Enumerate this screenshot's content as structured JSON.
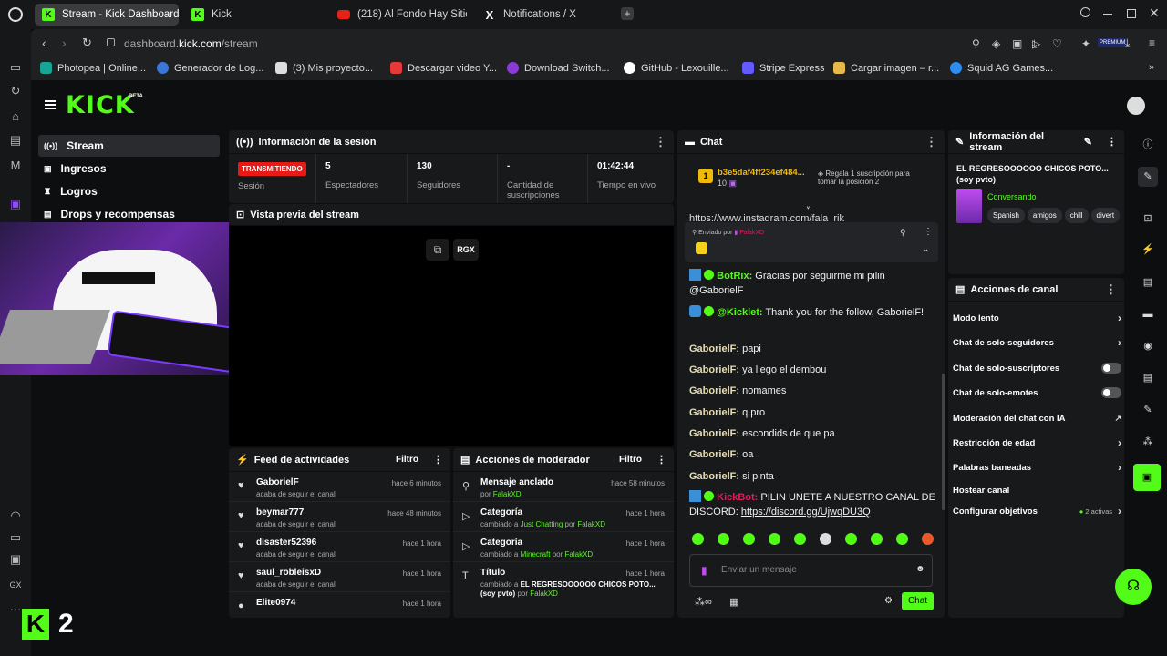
{
  "browser": {
    "tabs": [
      {
        "label": "Stream - Kick Dashboard",
        "icon": "kick"
      },
      {
        "label": "Kick",
        "icon": "kick"
      },
      {
        "label": "(218) Al Fondo Hay Sitio T",
        "icon": "youtube"
      },
      {
        "label": "Notifications / X",
        "icon": "x"
      }
    ],
    "url_prefix": "dashboard.",
    "url_host": "kick.com",
    "url_path": "/stream",
    "bookmarks": [
      "Photopea | Online...",
      "Generador de Log...",
      "(3) Mis proyecto...",
      "Descargar video Y...",
      "Download Switch...",
      "GitHub - Lexouille...",
      "Stripe Express",
      "Cargar imagen – r...",
      "Squid AG Games..."
    ],
    "gx_label": "GX",
    "premium_label": "PREMIUM"
  },
  "kick": {
    "logo": "KICK",
    "beta": "BETA",
    "nav": [
      "Stream",
      "Ingresos",
      "Logros",
      "Drops y recompensas"
    ],
    "bottom_logo_num": "2"
  },
  "session": {
    "title": "Información de la sesión",
    "live_badge": "TRANSMITIENDO",
    "live_label": "Sesión",
    "stats": [
      {
        "value": "5",
        "label": "Espectadores"
      },
      {
        "value": "130",
        "label": "Seguidores"
      },
      {
        "value": "-",
        "label": "Cantidad de suscripciones"
      },
      {
        "value": "01:42:44",
        "label": "Tiempo en vivo"
      }
    ]
  },
  "preview": {
    "title": "Vista previa del stream",
    "rgx": "RGX"
  },
  "feed": {
    "title": "Feed de actividades",
    "filter": "Filtro",
    "items": [
      {
        "name": "GaborielF",
        "sub": "acaba de seguir el canal",
        "time": "hace 6 minutos"
      },
      {
        "name": "beymar777",
        "sub": "acaba de seguir el canal",
        "time": "hace 48 minutos"
      },
      {
        "name": "disaster52396",
        "sub": "acaba de seguir el canal",
        "time": "hace 1 hora"
      },
      {
        "name": "saul_robleisxD",
        "sub": "acaba de seguir el canal",
        "time": "hace 1 hora"
      },
      {
        "name": "Elite0974",
        "sub": "",
        "time": "hace 1 hora"
      }
    ]
  },
  "mod": {
    "title": "Acciones de moderador",
    "filter": "Filtro",
    "items": [
      {
        "name": "Mensaje anclado",
        "sub": "por ",
        "by": "FalakXD",
        "time": "hace 58 minutos"
      },
      {
        "name": "Categoría",
        "sub": "cambiado a ",
        "value": "Just Chatting",
        "by": "FalakXD",
        "time": "hace 1 hora"
      },
      {
        "name": "Categoría",
        "sub": "cambiado a ",
        "value": "Minecraft",
        "by": "FalakXD",
        "time": "hace 1 hora"
      },
      {
        "name": "Título",
        "sub": "cambiado a ",
        "value": "EL REGRESOOOOOO CHICOS POTO... (soy pvto)",
        "by": "FalakXD",
        "time": "hace 1 hora"
      }
    ],
    "por": "por"
  },
  "chat": {
    "title": "Chat",
    "gifter_user": "b3e5daf4ff234ef484...",
    "gifter_count": "10",
    "gifter_rank": "1",
    "gift_text": "Regala 1 suscripción para tomar la posición 2",
    "partial_link": "https://www.instagram.com/fala_rjk",
    "pinned_by": "Enviado por",
    "pinned_user": "FalakXD",
    "messages": [
      {
        "user": "BotRix:",
        "text": " Gracias por seguirme mi pilin @GaborielF",
        "color": "#53fc18"
      },
      {
        "user": "@Kicklet:",
        "text": " Thank you for the follow, GaborielF!",
        "color": "#53fc18"
      },
      {
        "user": "GaborielF:",
        "text": " papi",
        "color": "#e6ddb3"
      },
      {
        "user": "GaborielF:",
        "text": " ya llego el dembou",
        "color": "#e6ddb3"
      },
      {
        "user": "GaborielF:",
        "text": " nomames",
        "color": "#e6ddb3"
      },
      {
        "user": "GaborielF:",
        "text": " q pro",
        "color": "#e6ddb3"
      },
      {
        "user": "GaborielF:",
        "text": " escondids de que pa",
        "color": "#e6ddb3"
      },
      {
        "user": "GaborielF:",
        "text": " oa",
        "color": "#e6ddb3"
      },
      {
        "user": "GaborielF:",
        "text": " si pinta",
        "color": "#e6ddb3"
      }
    ],
    "kickbot_user": "KickBot:",
    "kickbot_text": " PILIN UNETE A NUESTRO CANAL DE DISCORD: ",
    "kickbot_link": "https://discord.gg/UjwqDU3Q",
    "input_placeholder": "Enviar un mensaje",
    "send_label": "Chat"
  },
  "stream_info": {
    "title": "Información del stream",
    "stream_title": "EL REGRESOOOOOO CHICOS POTO... (soy pvto)",
    "category": "Conversando",
    "tags": [
      "Spanish",
      "amigos",
      "chill",
      "divert"
    ]
  },
  "channel_actions": {
    "title": "Acciones de canal",
    "rows": [
      {
        "label": "Modo lento",
        "control": "chevron"
      },
      {
        "label": "Chat de solo-seguidores",
        "control": "chevron"
      },
      {
        "label": "Chat de solo-suscriptores",
        "control": "toggle"
      },
      {
        "label": "Chat de solo-emotes",
        "control": "toggle"
      },
      {
        "label": "Moderación del chat con IA",
        "control": "external"
      },
      {
        "label": "Restricción de edad",
        "control": "chevron"
      },
      {
        "label": "Palabras baneadas",
        "control": "chevron"
      },
      {
        "label": "Hostear canal",
        "control": "none"
      },
      {
        "label": "Configurar objetivos",
        "control": "chevron"
      }
    ],
    "goals_active": "2 activas"
  },
  "colors": {
    "accent": "#53fc18",
    "live": "#e91916"
  }
}
